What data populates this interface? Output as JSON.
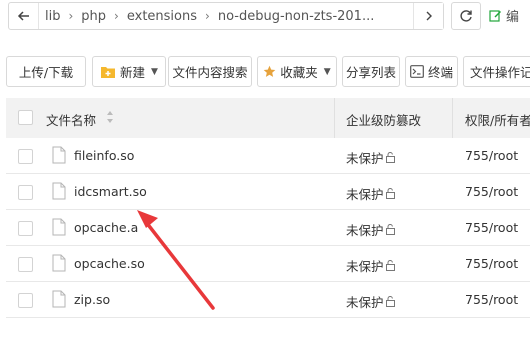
{
  "pathbar": {
    "crumbs": [
      "lib",
      "php",
      "extensions",
      "no-debug-non-zts-201..."
    ],
    "edit_label": "编"
  },
  "toolbar": {
    "upload_download": "上传/下载",
    "new": "新建",
    "content_search": "文件内容搜索",
    "favorites": "收藏夹",
    "share_list": "分享列表",
    "terminal": "终端",
    "operation_log": "文件操作记"
  },
  "table": {
    "headers": {
      "name": "文件名称",
      "protection": "企业级防篡改",
      "permission": "权限/所有者"
    },
    "rows": [
      {
        "name": "fileinfo.so",
        "protection": "未保护",
        "permission": "755/root"
      },
      {
        "name": "idcsmart.so",
        "protection": "未保护",
        "permission": "755/root"
      },
      {
        "name": "opcache.a",
        "protection": "未保护",
        "permission": "755/root"
      },
      {
        "name": "opcache.so",
        "protection": "未保护",
        "permission": "755/root"
      },
      {
        "name": "zip.so",
        "protection": "未保护",
        "permission": "755/root"
      }
    ]
  },
  "colors": {
    "annotation_arrow": "#e8383a",
    "folder_yellow": "#f5b82e",
    "star_yellow": "#e6a23c"
  }
}
